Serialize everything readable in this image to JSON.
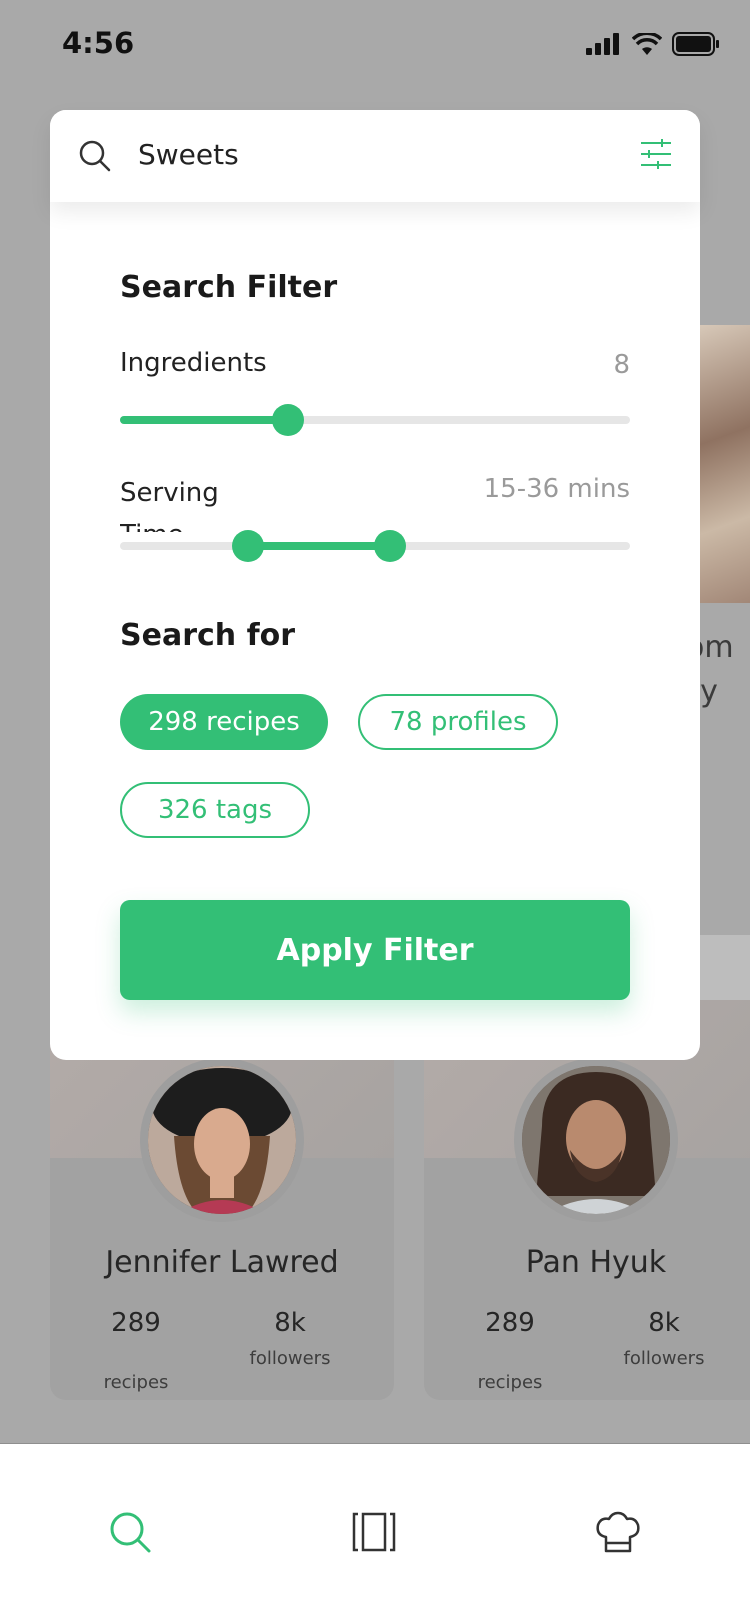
{
  "status_bar": {
    "time": "4:56"
  },
  "search": {
    "query": "Sweets"
  },
  "filter": {
    "title": "Search Filter",
    "ingredients": {
      "label": "Ingredients",
      "value": "8",
      "fill_fraction": 0.33
    },
    "serving_time": {
      "label": "Serving Time",
      "value": "15-36 mins",
      "range_fraction": [
        0.25,
        0.53
      ]
    },
    "search_for_title": "Search for",
    "chips": [
      {
        "label": "298 recipes",
        "active": true
      },
      {
        "label": "78 profiles",
        "active": false
      },
      {
        "label": "326 tags",
        "active": false
      }
    ],
    "apply_label": "Apply Filter"
  },
  "background": {
    "partial_text": [
      "om",
      "rry"
    ],
    "profiles": [
      {
        "name": "Jennifer Lawred",
        "recipes": "289",
        "recipes_label": "recipes",
        "followers": "8k",
        "followers_label": "followers"
      },
      {
        "name": "Pan Hyuk",
        "recipes": "289",
        "recipes_label": "recipes",
        "followers": "8k",
        "followers_label": "followers"
      }
    ]
  },
  "bottom_nav": [
    {
      "icon": "search-icon",
      "active": true
    },
    {
      "icon": "recipe-book-icon",
      "active": false
    },
    {
      "icon": "chef-hat-icon",
      "active": false
    }
  ],
  "colors": {
    "accent": "#33bf76",
    "overlay": "#a9a9a9"
  }
}
